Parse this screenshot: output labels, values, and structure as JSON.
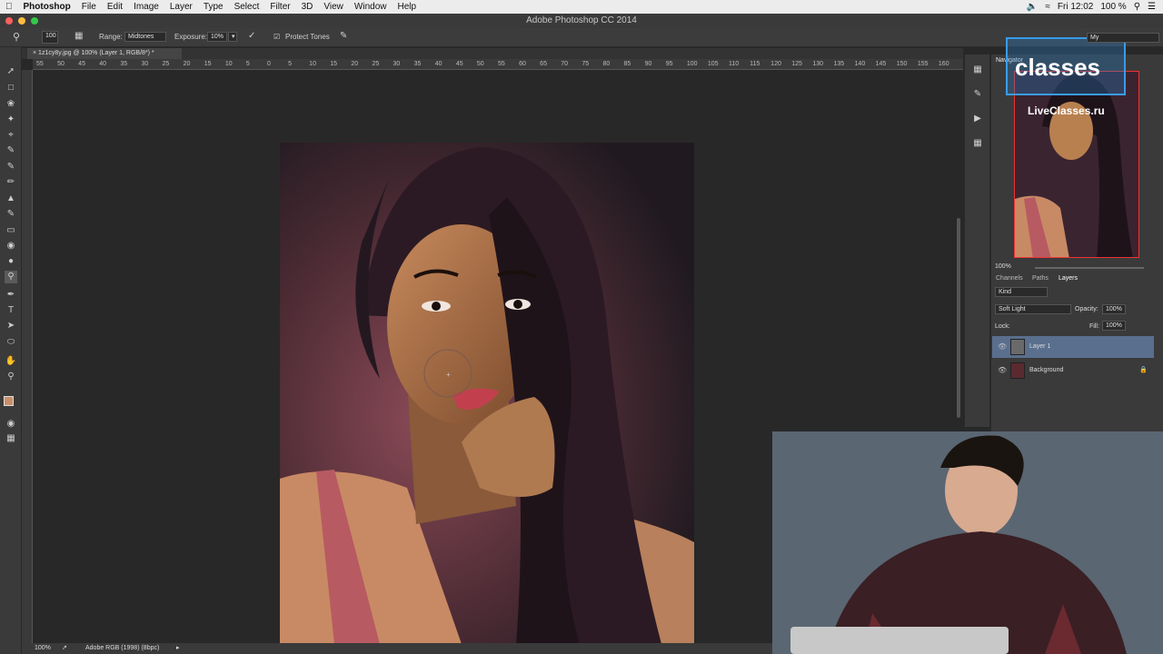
{
  "menubar": {
    "apple": "",
    "app_name": "Photoshop",
    "items": [
      "File",
      "Edit",
      "Image",
      "Layer",
      "Type",
      "Select",
      "Filter",
      "3D",
      "View",
      "Window",
      "Help"
    ],
    "clock": "Fri 12:02",
    "battery": "100 %"
  },
  "window_title": "Adobe Photoshop CC 2014",
  "options": {
    "brush_size": "100",
    "range_label": "Range:",
    "range_value": "Midtones",
    "exposure_label": "Exposure:",
    "exposure_value": "10%",
    "protect_tones_label": "Protect Tones"
  },
  "document": {
    "tab_label": "1z1cy8y.jpg @ 100% (Layer 1, RGB/8*) *"
  },
  "ruler": {
    "h_ticks": [
      "55",
      "50",
      "45",
      "40",
      "35",
      "30",
      "25",
      "20",
      "15",
      "10",
      "5",
      "0",
      "5",
      "10",
      "15",
      "20",
      "25",
      "30",
      "35",
      "40",
      "45",
      "50",
      "55",
      "60",
      "65",
      "70",
      "75",
      "80",
      "85",
      "90",
      "95",
      "100",
      "105",
      "110",
      "115",
      "120",
      "125",
      "130",
      "135",
      "140",
      "145",
      "150",
      "155",
      "160"
    ]
  },
  "status": {
    "zoom": "100%",
    "profile": "Adobe RGB (1998) (8bpc)"
  },
  "navigator": {
    "title": "Navigator",
    "zoom": "100%",
    "watermark": "LiveClasses.ru",
    "logo_text": "classes",
    "workspace": "My"
  },
  "layers_panel": {
    "tabs": [
      "Channels",
      "Paths",
      "Layers"
    ],
    "filter_kind": "Kind",
    "blend_mode": "Soft Light",
    "opacity_label": "Opacity:",
    "opacity_value": "100%",
    "lock_label": "Lock:",
    "fill_label": "Fill:",
    "fill_value": "100%",
    "layers": [
      {
        "name": "Layer 1",
        "selected": true
      },
      {
        "name": "Background",
        "selected": false
      }
    ]
  },
  "colors": {
    "selection": "#5a6f8e",
    "panel_bg": "#3a3a3a",
    "accent_logo": "#3a9be8",
    "foreground_swatch": "#c8906a"
  }
}
